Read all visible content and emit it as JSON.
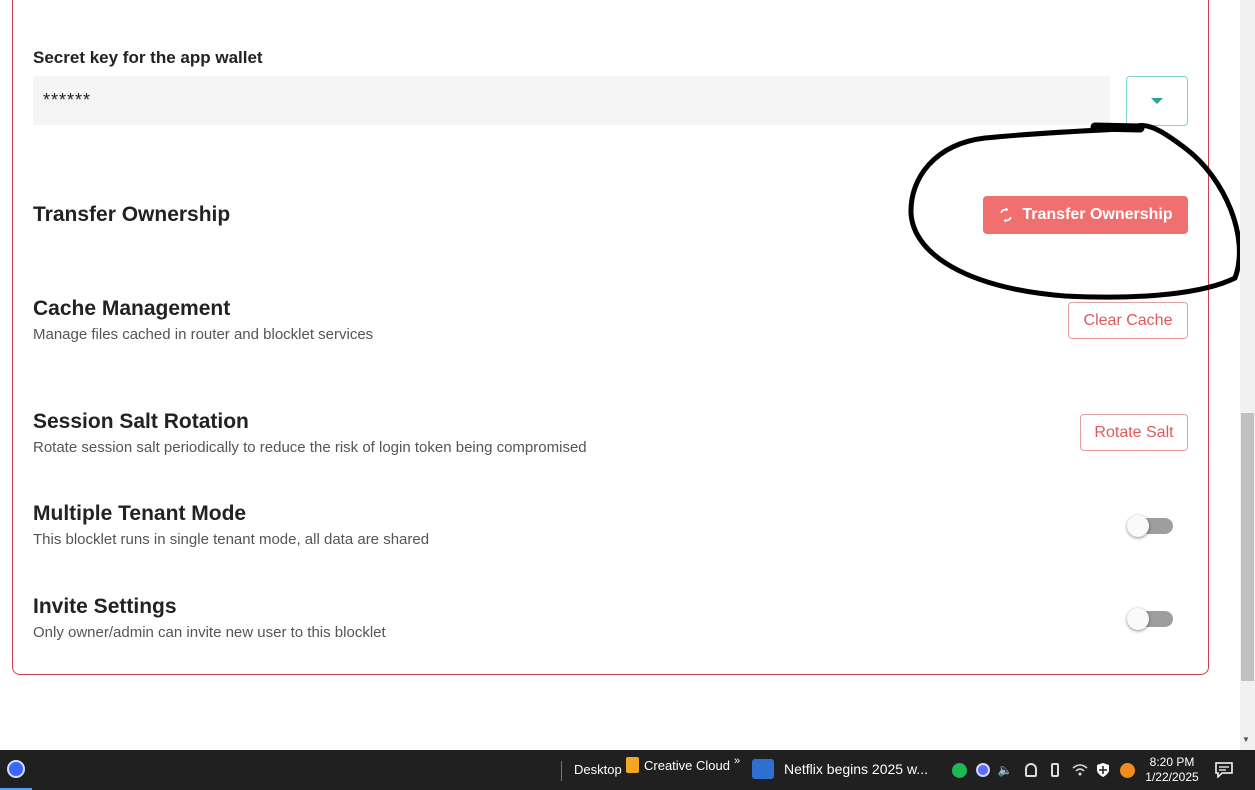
{
  "settings": {
    "secret_key_label": "Secret key for the app wallet",
    "secret_key_value": "******",
    "transfer": {
      "title": "Transfer Ownership",
      "button_label": "Transfer Ownership",
      "button_color": "#f07070"
    },
    "cache": {
      "title": "Cache Management",
      "description": "Manage files cached in router and blocklet services",
      "button_label": "Clear Cache"
    },
    "salt": {
      "title": "Session Salt Rotation",
      "description": "Rotate session salt periodically to reduce the risk of login token being compromised",
      "button_label": "Rotate Salt"
    },
    "tenant": {
      "title": "Multiple Tenant Mode",
      "description": "This blocklet runs in single tenant mode, all data are shared",
      "enabled": false
    },
    "invite": {
      "title": "Invite Settings",
      "description": "Only owner/admin can invite new user to this blocklet",
      "enabled": false
    },
    "panel_border_color": "#d0404a",
    "accent_color": "#26a69a"
  },
  "taskbar": {
    "desktop_label": "Desktop",
    "creative_cloud_label": "Creative Cloud",
    "overflow_glyph": "»",
    "window_title": "Netflix begins 2025 w...",
    "time": "8:20 PM",
    "date": "1/22/2025",
    "icons": [
      "start-icon",
      "creative-cloud-icon",
      "news-icon",
      "spotify-icon",
      "app-tray-icon",
      "volume-icon",
      "vpn-icon",
      "usb-icon",
      "wifi-icon",
      "security-icon",
      "vlc-icon",
      "notification-icon"
    ]
  }
}
